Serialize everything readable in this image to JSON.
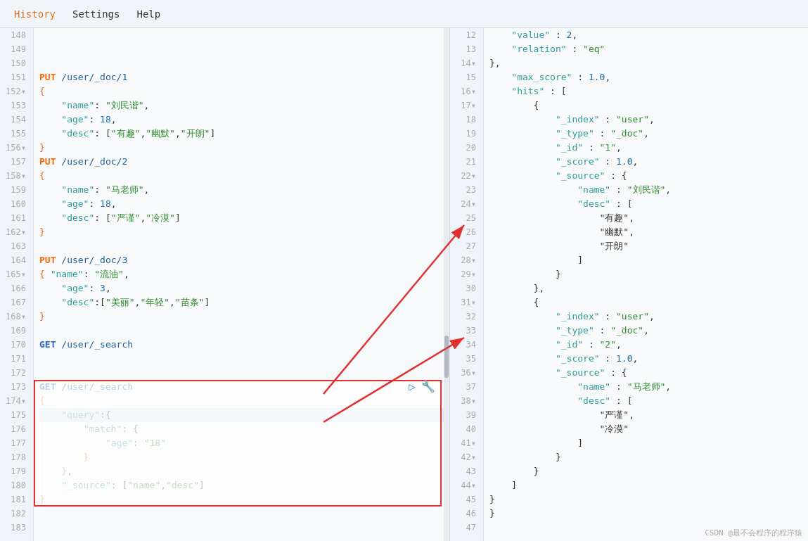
{
  "menubar": {
    "items": [
      {
        "label": "History",
        "active": true
      },
      {
        "label": "Settings",
        "active": false
      },
      {
        "label": "Help",
        "active": false
      }
    ]
  },
  "left_panel": {
    "lines": [
      {
        "num": "148",
        "content": "",
        "type": "empty"
      },
      {
        "num": "149",
        "content": "",
        "type": "empty"
      },
      {
        "num": "150",
        "content": "",
        "type": "empty"
      },
      {
        "num": "151",
        "content": "PUT /user/_doc/1",
        "type": "http"
      },
      {
        "num": "152",
        "content": "{",
        "type": "brace",
        "fold": true
      },
      {
        "num": "153",
        "content": "    \"name\":\"刘民谐\",",
        "type": "code"
      },
      {
        "num": "154",
        "content": "    \"age\": 18,",
        "type": "code"
      },
      {
        "num": "155",
        "content": "    \"desc\": [\"有趣\",\"幽默\",\"开朗\"]",
        "type": "code"
      },
      {
        "num": "156",
        "content": "}",
        "type": "brace",
        "fold": true
      },
      {
        "num": "157",
        "content": "PUT /user/_doc/2",
        "type": "http"
      },
      {
        "num": "158",
        "content": "{",
        "type": "brace",
        "fold": true
      },
      {
        "num": "159",
        "content": "    \"name\":\"马老师\",",
        "type": "code"
      },
      {
        "num": "160",
        "content": "    \"age\": 18,",
        "type": "code"
      },
      {
        "num": "161",
        "content": "    \"desc\": [\"严谨\",\"冷漠\"]",
        "type": "code"
      },
      {
        "num": "162",
        "content": "}",
        "type": "brace",
        "fold": true
      },
      {
        "num": "163",
        "content": "",
        "type": "empty"
      },
      {
        "num": "164",
        "content": "PUT /user/_doc/3",
        "type": "http"
      },
      {
        "num": "165",
        "content": "{ \"name\":\"流油\",",
        "type": "code",
        "fold": true
      },
      {
        "num": "166",
        "content": "    \"age\": 3,",
        "type": "code"
      },
      {
        "num": "167",
        "content": "    \"desc\":[\"美丽\",\"年轻\",\"苗条\"]",
        "type": "code"
      },
      {
        "num": "168",
        "content": "}",
        "type": "brace",
        "fold": true
      },
      {
        "num": "169",
        "content": "",
        "type": "empty"
      },
      {
        "num": "170",
        "content": "GET /user/_search",
        "type": "http"
      },
      {
        "num": "171",
        "content": "",
        "type": "empty"
      },
      {
        "num": "172",
        "content": "",
        "type": "empty"
      },
      {
        "num": "173",
        "content": "GET /user/_search",
        "type": "http_highlighted"
      },
      {
        "num": "174",
        "content": "{",
        "type": "brace",
        "fold": true
      },
      {
        "num": "175",
        "content": "    \"query\":{",
        "type": "code_selected"
      },
      {
        "num": "176",
        "content": "        \"match\": {",
        "type": "code"
      },
      {
        "num": "177",
        "content": "            \"age\": \"18\"",
        "type": "code"
      },
      {
        "num": "178",
        "content": "        }",
        "type": "code"
      },
      {
        "num": "179",
        "content": "    },",
        "type": "code"
      },
      {
        "num": "180",
        "content": "    \"_source\": [\"name\",\"desc\"]",
        "type": "code"
      },
      {
        "num": "181",
        "content": "}",
        "type": "brace"
      },
      {
        "num": "182",
        "content": "",
        "type": "empty"
      },
      {
        "num": "183",
        "content": "",
        "type": "empty"
      }
    ]
  },
  "right_panel": {
    "lines": [
      {
        "num": "12",
        "content": "    \"value\" : 2,"
      },
      {
        "num": "13",
        "content": "    \"relation\" : \"eq\""
      },
      {
        "num": "14",
        "content": "},",
        "fold": true
      },
      {
        "num": "15",
        "content": "    \"max_score\" : 1.0,"
      },
      {
        "num": "16",
        "content": "    \"hits\" : [",
        "fold": true
      },
      {
        "num": "17",
        "content": "        {",
        "fold": true
      },
      {
        "num": "18",
        "content": "            \"_index\" : \"user\","
      },
      {
        "num": "19",
        "content": "            \"_type\" : \"_doc\","
      },
      {
        "num": "20",
        "content": "            \"_id\" : \"1\","
      },
      {
        "num": "21",
        "content": "            \"_score\" : 1.0,"
      },
      {
        "num": "22",
        "content": "            \"_source\" : {",
        "fold": true
      },
      {
        "num": "23",
        "content": "                \"name\" : \"刘民谐\","
      },
      {
        "num": "24",
        "content": "                \"desc\" : [",
        "fold": true
      },
      {
        "num": "25",
        "content": "                    \"有趣\","
      },
      {
        "num": "26",
        "content": "                    \"幽默\","
      },
      {
        "num": "27",
        "content": "                    \"开朗\""
      },
      {
        "num": "28",
        "content": "                ]",
        "fold": true
      },
      {
        "num": "29",
        "content": "            }",
        "fold": true
      },
      {
        "num": "30",
        "content": "        },"
      },
      {
        "num": "31",
        "content": "        {",
        "fold": true
      },
      {
        "num": "32",
        "content": "            \"_index\" : \"user\","
      },
      {
        "num": "33",
        "content": "            \"_type\" : \"_doc\","
      },
      {
        "num": "34",
        "content": "            \"_id\" : \"2\","
      },
      {
        "num": "35",
        "content": "            \"_score\" : 1.0,"
      },
      {
        "num": "36",
        "content": "            \"_source\" : {",
        "fold": true
      },
      {
        "num": "37",
        "content": "                \"name\" : \"马老师\","
      },
      {
        "num": "38",
        "content": "                \"desc\" : [",
        "fold": true
      },
      {
        "num": "39",
        "content": "                    \"严谨\","
      },
      {
        "num": "40",
        "content": "                    \"冷漠\""
      },
      {
        "num": "41",
        "content": "                ]",
        "fold": true
      },
      {
        "num": "42",
        "content": "            }",
        "fold": true
      },
      {
        "num": "43",
        "content": "        }"
      },
      {
        "num": "44",
        "content": "    ]",
        "fold": true
      },
      {
        "num": "45",
        "content": "}"
      },
      {
        "num": "46",
        "content": "}"
      },
      {
        "num": "47",
        "content": ""
      }
    ]
  },
  "watermark": "CSDN @最不会程序的程序猿"
}
